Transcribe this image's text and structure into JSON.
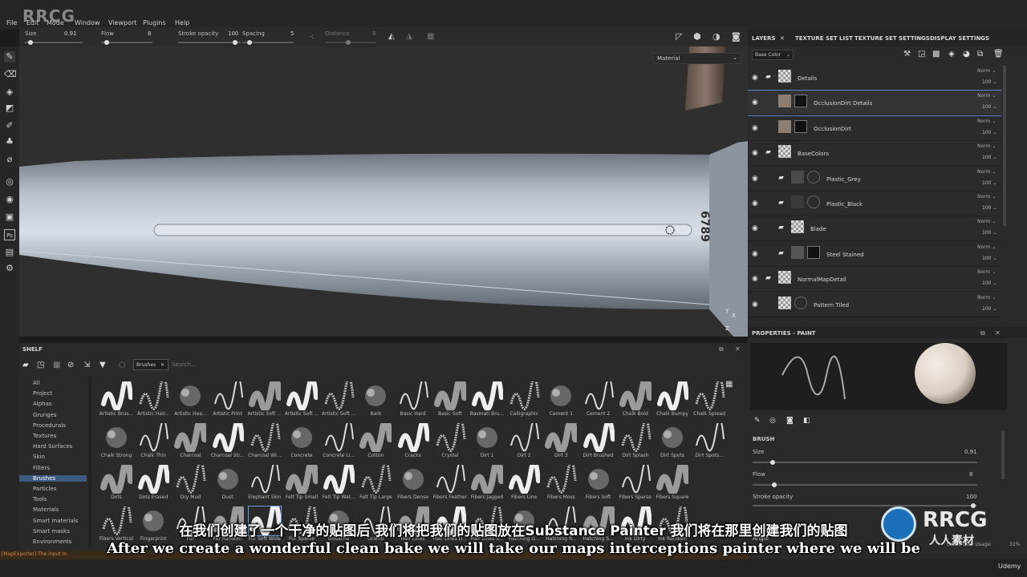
{
  "watermark_logo": "RRCG",
  "menu": [
    "File",
    "Edit",
    "Mode",
    "Window",
    "Viewport",
    "Plugins",
    "Help"
  ],
  "tool_options": {
    "size_label": "Size",
    "size_value": "0.91",
    "flow_label": "Flow",
    "flow_value": "8",
    "stroke_label": "Stroke opacity",
    "stroke_value": "100",
    "spacing_label": "Spacing",
    "spacing_value": "5",
    "distance_label": "Distance",
    "distance_value": "8"
  },
  "viewport": {
    "mode_select": "Material",
    "blade_engraving": "6789",
    "axis_y": "Y",
    "axis_x": "X",
    "axis_z": "Z"
  },
  "right_tabs": [
    "LAYERS",
    "TEXTURE SET LIST",
    "TEXTURE SET SETTINGS",
    "DISPLAY SETTINGS"
  ],
  "channel_select": "Base Color",
  "layers": [
    {
      "name": "Details",
      "blend": "Norm",
      "opacity": "100"
    },
    {
      "name": "OcclusionDirt Details",
      "blend": "Norm",
      "opacity": "100"
    },
    {
      "name": "OcclusionDirt",
      "blend": "Norm",
      "opacity": "100"
    },
    {
      "name": "BaseColors",
      "blend": "Norm",
      "opacity": "100"
    },
    {
      "name": "Plastic_Grey",
      "blend": "Norm",
      "opacity": "100"
    },
    {
      "name": "Plastic_Black",
      "blend": "Norm",
      "opacity": "100"
    },
    {
      "name": "Blade",
      "blend": "Norm",
      "opacity": "100"
    },
    {
      "name": "Steel Stained",
      "blend": "Norm",
      "opacity": "100"
    },
    {
      "name": "NormalMapDetail",
      "blend": "Norm",
      "opacity": "100"
    },
    {
      "name": "Pattern Tiled",
      "blend": "Norm",
      "opacity": "100"
    }
  ],
  "properties": {
    "title": "PROPERTIES - PAINT",
    "section": "BRUSH",
    "size_label": "Size",
    "size_value": "0.91",
    "flow_label": "Flow",
    "flow_value": "8",
    "stroke_label": "Stroke opacity",
    "stroke_value": "100",
    "angle_label": "Angle"
  },
  "shelf": {
    "title": "SHELF",
    "filter_tag": "Brushes",
    "search_placeholder": "Search...",
    "categories": [
      "All",
      "Project",
      "Alphas",
      "Grunges",
      "Procedurals",
      "Textures",
      "Hard Surfaces",
      "Skin",
      "Filters",
      "Brushes",
      "Particles",
      "Tools",
      "Materials",
      "Smart materials",
      "Smart masks",
      "Environments"
    ],
    "selected_category": "Brushes",
    "brushes": [
      [
        "Artistic Brus...",
        "Artistic Hair...",
        "Artistic Hea...",
        "Artistic Print",
        "Artistic Soft ...",
        "Artistic Soft ...",
        "Artistic Soft ...",
        "Bark",
        "Basic Hard",
        "Basic Soft",
        "Basmati Bru...",
        "Calligraphic",
        "Cement 1",
        "Cement 2",
        "Chalk Bold",
        "Chalk Bumpy",
        "Chalk Spread"
      ],
      [
        "Chalk Strong",
        "Chalk Thin",
        "Charcoal",
        "Charcoal Str...",
        "Charcoal Wi...",
        "Concrete",
        "Concrete Li...",
        "Cotton",
        "Cracks",
        "Crystal",
        "Dirt 1",
        "Dirt 2",
        "Dirt 3",
        "Dirt Brushed",
        "Dirt Splash",
        "Dirt Spots",
        "Dirt Spots..."
      ],
      [
        "Dots",
        "Dots Erased",
        "Dry Mud",
        "Dust",
        "Elephant Skin",
        "Felt Tip Small",
        "Felt Tip Wat...",
        "Felt Tip Large",
        "Fibers Dense",
        "Fibers Feather",
        "Fibers Jagged",
        "Fibers Line",
        "Fibers Moss",
        "Fibers Soft",
        "Fibers Sparse",
        "Fibers Square"
      ],
      [
        "Fibers Vertical",
        "Fingerprint",
        "Fur",
        "Fur Random",
        "Fur Soft Wide",
        "Fur Sparse",
        "Gouache",
        "Graffiti",
        "Hair Lines",
        "Hair Lines D...",
        "Hair Lines S...",
        "Hatching G...",
        "Hatching R...",
        "Hatching S...",
        "Ink Dirty",
        "Ink Random"
      ]
    ]
  },
  "status": {
    "log": "[MapExporter] The input m",
    "cache": "Cache Disk Usage:",
    "cache_pct": "31%"
  },
  "subtitle_cn": "在我们创建了一个干净的贴图后 我们将把我们的贴图放在Substance Painter 我们将在那里创建我们的贴图",
  "subtitle_en": "After we create a wonderful clean bake we will take our maps interceptions painter where we will be",
  "bottom_logo": "RRCG",
  "bottom_logo_cn": "人人素材",
  "udemy": "Udemy"
}
